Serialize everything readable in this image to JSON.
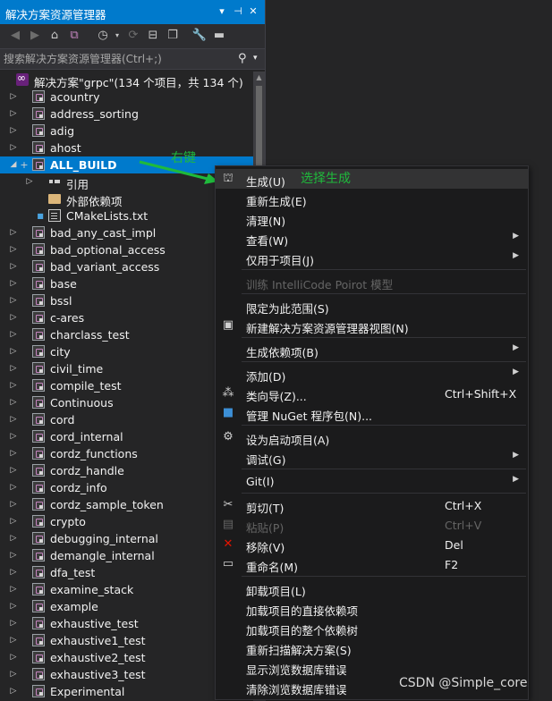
{
  "panel": {
    "title": "解决方案资源管理器",
    "title_buttons": [
      "▾",
      "⊣",
      "✕"
    ],
    "toolbar_icons": [
      "back-icon",
      "forward-icon",
      "home-icon",
      "vs-switch-view-icon",
      "history-icon",
      "refresh-icon",
      "collapse-all-icon",
      "show-all-files-icon",
      "properties-wrench-icon",
      "preview-icon"
    ],
    "search_placeholder": "搜索解决方案资源管理器(Ctrl+;)"
  },
  "solution": {
    "label": "解决方案\"grpc\"(134 个项目，共 134 个)"
  },
  "tree_items": [
    {
      "label": "acountry",
      "kind": "project",
      "expanded": false
    },
    {
      "label": "address_sorting",
      "kind": "project",
      "expanded": false
    },
    {
      "label": "adig",
      "kind": "project",
      "expanded": false
    },
    {
      "label": "ahost",
      "kind": "project",
      "expanded": false
    },
    {
      "label": "ALL_BUILD",
      "kind": "project",
      "expanded": true,
      "selected": true
    },
    {
      "label": "引用",
      "kind": "references",
      "child": true,
      "expanded": false
    },
    {
      "label": "外部依赖项",
      "kind": "folder",
      "child": true
    },
    {
      "label": "CMakeLists.txt",
      "kind": "file",
      "child": true
    },
    {
      "label": "bad_any_cast_impl",
      "kind": "project",
      "expanded": false
    },
    {
      "label": "bad_optional_access",
      "kind": "project",
      "expanded": false
    },
    {
      "label": "bad_variant_access",
      "kind": "project",
      "expanded": false
    },
    {
      "label": "base",
      "kind": "project",
      "expanded": false
    },
    {
      "label": "bssl",
      "kind": "project",
      "expanded": false
    },
    {
      "label": "c-ares",
      "kind": "project",
      "expanded": false
    },
    {
      "label": "charclass_test",
      "kind": "project",
      "expanded": false
    },
    {
      "label": "city",
      "kind": "project",
      "expanded": false
    },
    {
      "label": "civil_time",
      "kind": "project",
      "expanded": false
    },
    {
      "label": "compile_test",
      "kind": "project",
      "expanded": false
    },
    {
      "label": "Continuous",
      "kind": "project",
      "expanded": false
    },
    {
      "label": "cord",
      "kind": "project",
      "expanded": false
    },
    {
      "label": "cord_internal",
      "kind": "project",
      "expanded": false
    },
    {
      "label": "cordz_functions",
      "kind": "project",
      "expanded": false
    },
    {
      "label": "cordz_handle",
      "kind": "project",
      "expanded": false
    },
    {
      "label": "cordz_info",
      "kind": "project",
      "expanded": false
    },
    {
      "label": "cordz_sample_token",
      "kind": "project",
      "expanded": false
    },
    {
      "label": "crypto",
      "kind": "project",
      "expanded": false
    },
    {
      "label": "debugging_internal",
      "kind": "project",
      "expanded": false
    },
    {
      "label": "demangle_internal",
      "kind": "project",
      "expanded": false
    },
    {
      "label": "dfa_test",
      "kind": "project",
      "expanded": false
    },
    {
      "label": "examine_stack",
      "kind": "project",
      "expanded": false
    },
    {
      "label": "example",
      "kind": "project",
      "expanded": false
    },
    {
      "label": "exhaustive_test",
      "kind": "project",
      "expanded": false
    },
    {
      "label": "exhaustive1_test",
      "kind": "project",
      "expanded": false
    },
    {
      "label": "exhaustive2_test",
      "kind": "project",
      "expanded": false
    },
    {
      "label": "exhaustive3_test",
      "kind": "project",
      "expanded": false
    },
    {
      "label": "Experimental",
      "kind": "project",
      "expanded": false
    }
  ],
  "context_menu": [
    {
      "label": "生成(U)",
      "icon": "build-icon",
      "hover": true
    },
    {
      "label": "重新生成(E)"
    },
    {
      "label": "清理(N)"
    },
    {
      "label": "查看(W)",
      "submenu": true
    },
    {
      "label": "仅用于项目(J)",
      "submenu": true
    },
    {
      "sep": true
    },
    {
      "label": "训练 IntelliCode Poirot 模型",
      "disabled": true
    },
    {
      "sep": true
    },
    {
      "label": "限定为此范围(S)"
    },
    {
      "label": "新建解决方案资源管理器视图(N)",
      "icon": "new-view-icon"
    },
    {
      "sep": true
    },
    {
      "label": "生成依赖项(B)",
      "submenu": true
    },
    {
      "sep": true
    },
    {
      "label": "添加(D)",
      "submenu": true
    },
    {
      "label": "类向导(Z)...",
      "icon": "class-wizard-icon",
      "shortcut": "Ctrl+Shift+X"
    },
    {
      "label": "管理 NuGet 程序包(N)...",
      "icon": "nuget-icon"
    },
    {
      "sep": true
    },
    {
      "label": "设为启动项目(A)",
      "icon": "gear-icon"
    },
    {
      "label": "调试(G)",
      "submenu": true
    },
    {
      "sep": true
    },
    {
      "label": "Git(I)",
      "submenu": true
    },
    {
      "sep": true
    },
    {
      "label": "剪切(T)",
      "icon": "scissors-icon",
      "shortcut": "Ctrl+X"
    },
    {
      "label": "粘贴(P)",
      "icon": "paste-icon",
      "shortcut": "Ctrl+V",
      "disabled": true
    },
    {
      "label": "移除(V)",
      "icon": "remove-x-icon",
      "shortcut": "Del"
    },
    {
      "label": "重命名(M)",
      "icon": "rename-icon",
      "shortcut": "F2"
    },
    {
      "sep": true
    },
    {
      "label": "卸载项目(L)"
    },
    {
      "label": "加载项目的直接依赖项"
    },
    {
      "label": "加载项目的整个依赖树"
    },
    {
      "label": "重新扫描解决方案(S)"
    },
    {
      "label": "显示浏览数据库错误"
    },
    {
      "label": "清除浏览数据库错误"
    }
  ],
  "annotations": {
    "right_click": "右键",
    "select_build": "选择生成",
    "color": "#1fba3c"
  },
  "watermark": "CSDN @Simple_core"
}
